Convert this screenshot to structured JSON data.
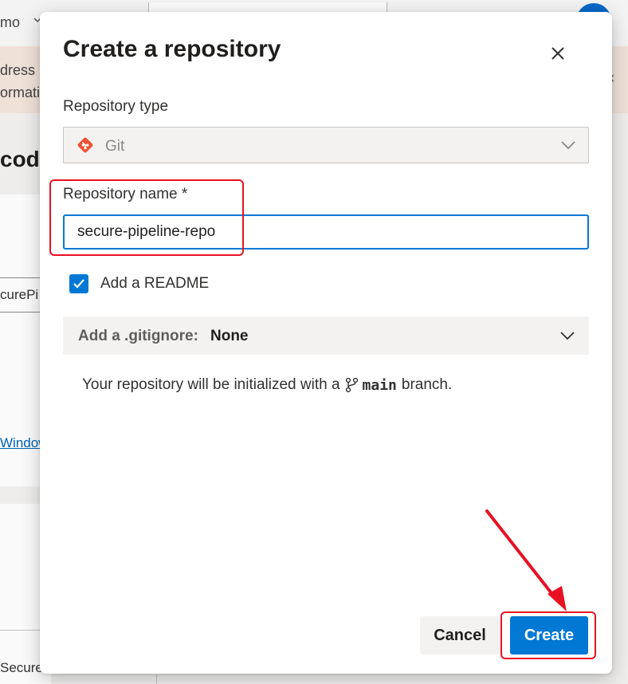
{
  "background": {
    "project_label": "mo",
    "banner_line1": "dress",
    "banner_line2": "ormati",
    "banner_close": "×",
    "heading": "cod",
    "input_text": "curePi",
    "link_text": "Window",
    "panel_text": "Secure..."
  },
  "dialog": {
    "title": "Create a repository",
    "close_icon": "close-icon",
    "repo_type": {
      "label": "Repository type",
      "value": "Git",
      "icon": "git-icon"
    },
    "repo_name": {
      "label": "Repository name *",
      "value": "secure-pipeline-repo"
    },
    "readme": {
      "label": "Add a README",
      "checked": true
    },
    "gitignore": {
      "prefix": "Add a .gitignore:",
      "value": "None"
    },
    "info": {
      "prefix": "Your repository will be initialized with a",
      "branch": "main",
      "suffix": "branch."
    },
    "buttons": {
      "cancel": "Cancel",
      "create": "Create"
    }
  },
  "colors": {
    "accent": "#0078d4",
    "annotation": "#e81123",
    "git_brand": "#f05133"
  }
}
